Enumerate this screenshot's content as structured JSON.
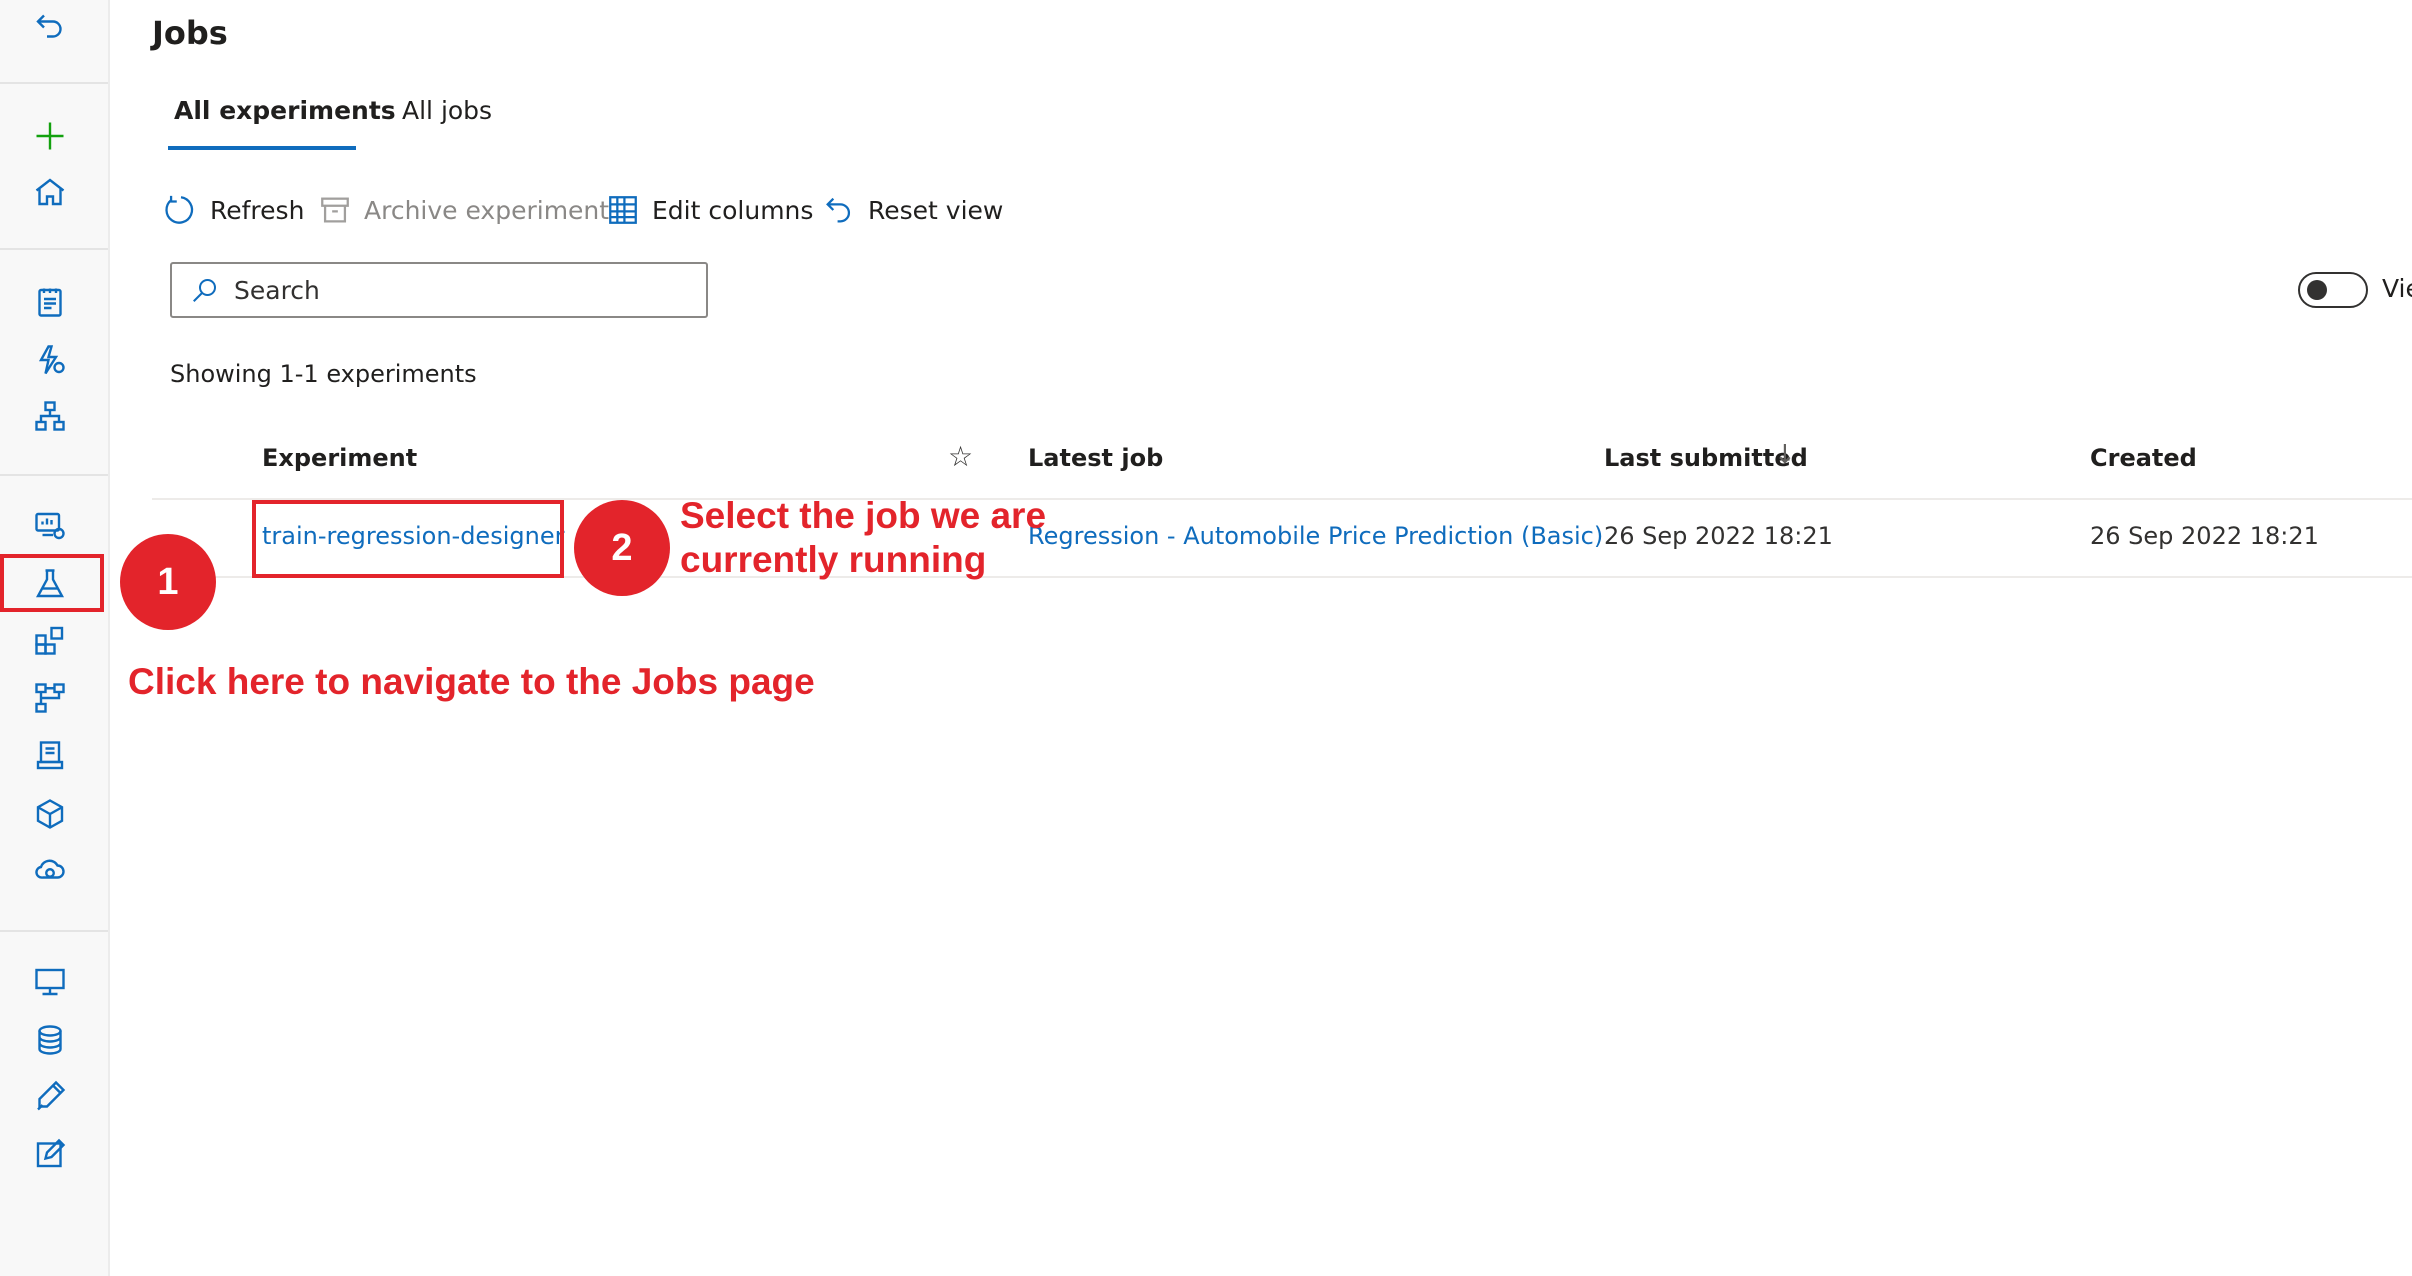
{
  "page": {
    "title": "Jobs"
  },
  "tabs": [
    {
      "label": "All experiments",
      "active": true
    },
    {
      "label": "All jobs",
      "active": false
    }
  ],
  "toolbar": {
    "refresh": "Refresh",
    "archive": "Archive experiment",
    "edit_columns": "Edit columns",
    "reset_view": "Reset view"
  },
  "search": {
    "placeholder": "Search"
  },
  "view_toggle": {
    "label": "Vie",
    "on": false
  },
  "showing": "Showing 1-1 experiments",
  "table": {
    "headers": {
      "experiment": "Experiment",
      "latest_job": "Latest job",
      "last_submitted": "Last submitted",
      "created": "Created"
    },
    "rows": [
      {
        "experiment": "train-regression-designer",
        "latest_job": "Regression - Automobile Price Prediction (Basic)",
        "last_submitted": "26 Sep 2022 18:21",
        "created": "26 Sep 2022 18:21"
      }
    ]
  },
  "annotations": {
    "step1_number": "1",
    "step1_text": "Click here to navigate to the Jobs page",
    "step2_number": "2",
    "step2_text_line1": "Select the job we are",
    "step2_text_line2": "currently running"
  },
  "colors": {
    "accent": "#0f6cbd",
    "annotation_red": "#e3242b",
    "add_icon_green": "#13a10e"
  },
  "rail_icons": [
    "collapse-icon",
    "add-icon",
    "home-icon",
    "notebook-icon",
    "automated-ml-icon",
    "designer-icon",
    "data-icon",
    "jobs-icon",
    "components-icon",
    "pipelines-icon",
    "environments-icon",
    "models-icon",
    "endpoints-icon",
    "compute-icon",
    "datastores-icon",
    "data-labeling-icon",
    "linked-services-icon"
  ]
}
